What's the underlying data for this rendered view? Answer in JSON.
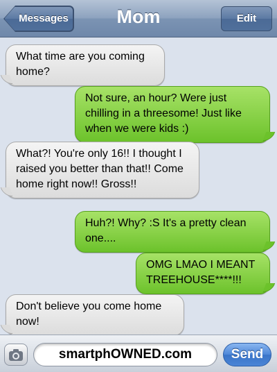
{
  "header": {
    "back_label": "Messages",
    "title": "Mom",
    "edit_label": "Edit"
  },
  "messages": [
    {
      "direction": "incoming",
      "text": "What time are you coming home?"
    },
    {
      "direction": "outgoing",
      "text": "Not sure, an hour? Were just chilling in a threesome! Just like when we were kids :)"
    },
    {
      "direction": "incoming",
      "text": "What?! You're only 16!! I thought I raised you better than that!! Come home right now!! Gross!!"
    },
    {
      "direction": "outgoing",
      "text": "Huh?! Why? :S It's a pretty clean one...."
    },
    {
      "direction": "outgoing",
      "text": "OMG LMAO I MEANT TREEHOUSE****!!!"
    },
    {
      "direction": "incoming",
      "text": "Don't believe you come home now!"
    }
  ],
  "composer": {
    "camera_icon": "camera-icon",
    "text_value": "smartphOWNED.com",
    "send_label": "Send"
  },
  "colors": {
    "incoming_bubble": "#dcdcdc",
    "outgoing_bubble": "#7ccf39",
    "navbar": "#7b93b3",
    "send_button": "#4a85d6"
  }
}
